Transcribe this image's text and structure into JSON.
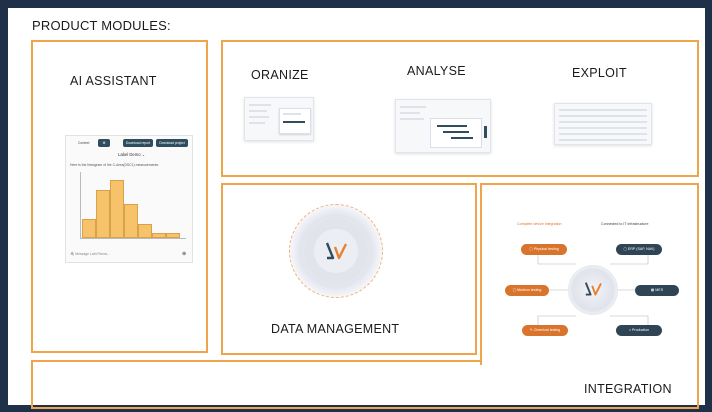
{
  "page": {
    "title": "PRODUCT MODULES:"
  },
  "colors": {
    "accent": "#f0a54a",
    "background": "#1f3149",
    "brand_orange": "#e8812f",
    "brand_dark": "#2f4d5e"
  },
  "ai_assistant": {
    "title": "AI ASSISTANT",
    "tabs": {
      "context": "Context",
      "download_report": "Download report",
      "download_project": "Download project"
    },
    "project_selector": "Label Demo",
    "prompt_text": "Here is the histogram of the C-Area(DSC1) measurements:",
    "message_placeholder": "Message LabVTerms...",
    "histogram": {
      "values": [
        4,
        10,
        12,
        7,
        3,
        1,
        1
      ]
    }
  },
  "data_analysis": {
    "organize_label": "ORANIZE",
    "analyse_label": "ANALYSE",
    "exploit_label": "EXPLOIT"
  },
  "data_management": {
    "title": "DATA MANAGEMENT",
    "logo_icon": "lv-logo-icon"
  },
  "integration": {
    "title": "INTEGRATION",
    "left_header": "Complete device integration",
    "right_header": "Connected to IT infrastructure",
    "nodes_left": [
      "Physical testing",
      "Medium testing",
      "Chemical testing"
    ],
    "nodes_right": [
      "ERP (SAP, NAV)",
      "MES",
      "Production"
    ]
  }
}
